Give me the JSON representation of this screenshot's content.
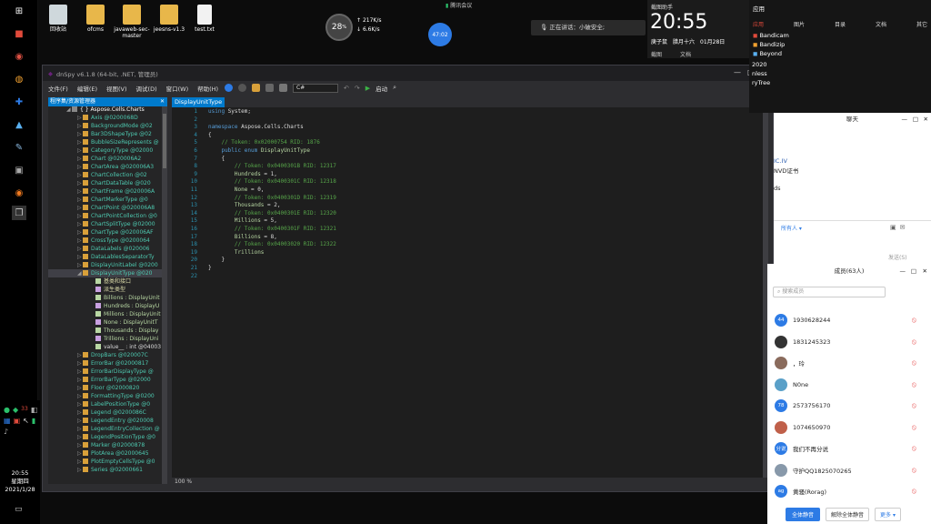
{
  "desktop": {
    "icons": [
      {
        "label": "回收站",
        "color": "#cfd8dc"
      },
      {
        "label": "ofcms",
        "color": "#e8b74a"
      },
      {
        "label": "javaweb-sec-master",
        "color": "#e8b74a"
      },
      {
        "label": "jeesns-v1.3",
        "color": "#e8b74a"
      },
      {
        "label": "test.txt",
        "color": "#f2f2f2"
      }
    ],
    "net_badge": {
      "percent": "28",
      "unit": "%",
      "up": "217",
      "up_unit": "K/s",
      "down": "6.6",
      "down_unit": "K/s"
    },
    "timer": "47:02",
    "meeting_label": "腾讯会议",
    "speaking": "正在讲话：小破安全;"
  },
  "dnspy": {
    "title": "dnSpy v6.1.8 (64-bit, .NET, 管理员)",
    "menu": [
      "文件(F)",
      "编辑(E)",
      "视图(V)",
      "调试(D)",
      "窗口(W)",
      "帮助(H)"
    ],
    "language": "C#",
    "run_label": "启动",
    "tree_header": "程序集/资源管理器",
    "tree": [
      {
        "text": "{ } Aspose.Cells.Charts",
        "indent": 0,
        "color": "#ffffff",
        "expanded": true
      },
      {
        "text": "Axis @0200068D",
        "indent": 1
      },
      {
        "text": "BackgroundMode @02",
        "indent": 1
      },
      {
        "text": "Bar3DShapeType @02",
        "indent": 1
      },
      {
        "text": "BubbleSizeRepresents @",
        "indent": 1
      },
      {
        "text": "CategoryType @02000",
        "indent": 1
      },
      {
        "text": "Chart @020006A2",
        "indent": 1
      },
      {
        "text": "ChartArea @020006A3",
        "indent": 1
      },
      {
        "text": "ChartCollection @02",
        "indent": 1
      },
      {
        "text": "ChartDataTable @020",
        "indent": 1
      },
      {
        "text": "ChartFrame @020006A",
        "indent": 1
      },
      {
        "text": "ChartMarkerType @0",
        "indent": 1
      },
      {
        "text": "ChartPoint @020006A8",
        "indent": 1
      },
      {
        "text": "ChartPointCollection @0",
        "indent": 1
      },
      {
        "text": "ChartSplitType @02000",
        "indent": 1
      },
      {
        "text": "ChartType @020006AF",
        "indent": 1
      },
      {
        "text": "CrossType @0200064",
        "indent": 1
      },
      {
        "text": "DataLabels @020006",
        "indent": 1
      },
      {
        "text": "DataLablesSeparatorTy",
        "indent": 1
      },
      {
        "text": "DisplayUnitLabel @0200",
        "indent": 1
      },
      {
        "text": "DisplayUnitType @020",
        "indent": 1,
        "selected": true,
        "expanded": true
      },
      {
        "text": "基类和接口",
        "indent": 2,
        "color": "#dcdcaa"
      },
      {
        "text": "派生类型",
        "indent": 2,
        "color": "#dcdcaa"
      },
      {
        "text": "Billions : DisplayUnit",
        "indent": 2,
        "color": "#b8d7a3"
      },
      {
        "text": "Hundreds : DisplayU",
        "indent": 2,
        "color": "#b8d7a3"
      },
      {
        "text": "Millions : DisplayUnit",
        "indent": 2,
        "color": "#b8d7a3"
      },
      {
        "text": "None : DisplayUnitT",
        "indent": 2,
        "color": "#b8d7a3"
      },
      {
        "text": "Thousands : Display",
        "indent": 2,
        "color": "#b8d7a3"
      },
      {
        "text": "Trillions : DisplayUni",
        "indent": 2,
        "color": "#b8d7a3"
      },
      {
        "text": "value__ : int @04003",
        "indent": 2,
        "color": "#dcdcdc"
      },
      {
        "text": "DropBars @020007C",
        "indent": 1
      },
      {
        "text": "ErrorBar @02000817",
        "indent": 1
      },
      {
        "text": "ErrorBarDisplayType @",
        "indent": 1
      },
      {
        "text": "ErrorBarType @02000",
        "indent": 1
      },
      {
        "text": "Floor @02000820",
        "indent": 1
      },
      {
        "text": "FormattingType @0200",
        "indent": 1
      },
      {
        "text": "LabelPositionType @0",
        "indent": 1
      },
      {
        "text": "Legend @0200086C",
        "indent": 1
      },
      {
        "text": "LegendEntry @020008",
        "indent": 1
      },
      {
        "text": "LegendEntryCollection @",
        "indent": 1
      },
      {
        "text": "LegendPositionType @0",
        "indent": 1
      },
      {
        "text": "Marker @02000878",
        "indent": 1
      },
      {
        "text": "PlotArea @02000645",
        "indent": 1
      },
      {
        "text": "PlotEmptyCellsType @0",
        "indent": 1
      },
      {
        "text": "Series @02000661",
        "indent": 1
      }
    ],
    "tab_label": "DisplayUnitType",
    "code": [
      {
        "n": "1",
        "parts": [
          [
            "using ",
            "#569cd6"
          ],
          [
            "System",
            "#dcdcdc"
          ],
          [
            ";",
            "#dcdcdc"
          ]
        ]
      },
      {
        "n": "2",
        "parts": []
      },
      {
        "n": "3",
        "parts": [
          [
            "namespace ",
            "#569cd6"
          ],
          [
            "Aspose.Cells.Charts",
            "#dcdcdc"
          ]
        ]
      },
      {
        "n": "4",
        "parts": [
          [
            "{",
            "#dcdcdc"
          ]
        ]
      },
      {
        "n": "5",
        "parts": [
          [
            "\t// Token: 0x02000754 RID: 1876",
            "#57a64a"
          ]
        ]
      },
      {
        "n": "6",
        "parts": [
          [
            "\tpublic enum ",
            "#569cd6"
          ],
          [
            "DisplayUnitType",
            "#b8d7a3"
          ]
        ]
      },
      {
        "n": "7",
        "parts": [
          [
            "\t{",
            "#dcdcdc"
          ]
        ]
      },
      {
        "n": "8",
        "parts": [
          [
            "\t\t// Token: 0x0400301B RID: 12317",
            "#57a64a"
          ]
        ]
      },
      {
        "n": "9",
        "parts": [
          [
            "\t\tHundreds",
            "#b8d7a3"
          ],
          [
            " = 1,",
            "#dcdcdc"
          ]
        ]
      },
      {
        "n": "10",
        "parts": [
          [
            "\t\t// Token: 0x0400301C RID: 12318",
            "#57a64a"
          ]
        ]
      },
      {
        "n": "11",
        "parts": [
          [
            "\t\tNone",
            "#b8d7a3"
          ],
          [
            " = 0,",
            "#dcdcdc"
          ]
        ]
      },
      {
        "n": "12",
        "parts": [
          [
            "\t\t// Token: 0x0400301D RID: 12319",
            "#57a64a"
          ]
        ]
      },
      {
        "n": "13",
        "parts": [
          [
            "\t\tThousands",
            "#b8d7a3"
          ],
          [
            " = 2,",
            "#dcdcdc"
          ]
        ]
      },
      {
        "n": "14",
        "parts": [
          [
            "\t\t// Token: 0x0400301E RID: 12320",
            "#57a64a"
          ]
        ]
      },
      {
        "n": "15",
        "parts": [
          [
            "\t\tMillions",
            "#b8d7a3"
          ],
          [
            " = 5,",
            "#dcdcdc"
          ]
        ]
      },
      {
        "n": "16",
        "parts": [
          [
            "\t\t// Token: 0x0400301F RID: 12321",
            "#57a64a"
          ]
        ]
      },
      {
        "n": "17",
        "parts": [
          [
            "\t\tBillions",
            "#b8d7a3"
          ],
          [
            " = 8,",
            "#dcdcdc"
          ]
        ]
      },
      {
        "n": "18",
        "parts": [
          [
            "\t\t// Token: 0x04003020 RID: 12322",
            "#57a64a"
          ]
        ]
      },
      {
        "n": "19",
        "parts": [
          [
            "\t\tTrillions",
            "#b8d7a3"
          ]
        ]
      },
      {
        "n": "20",
        "parts": [
          [
            "\t}",
            "#dcdcdc"
          ]
        ]
      },
      {
        "n": "21",
        "parts": [
          [
            "}",
            "#dcdcdc"
          ]
        ]
      },
      {
        "n": "22",
        "parts": []
      }
    ],
    "zoom": "100 %"
  },
  "clock": {
    "label": "截图助手",
    "time": "20:55",
    "weekday": "庚子鼠",
    "lunar": "腊月十六",
    "date": "01月28日",
    "links": [
      "截图",
      "文档"
    ]
  },
  "search_panel": {
    "title": "应用",
    "tabs": [
      "应用",
      "图片",
      "目录",
      "文档",
      "其它"
    ],
    "apps": [
      "Bandicam",
      "Bandizip",
      "Beyond"
    ],
    "extra": [
      "2020",
      "nless",
      "ryTree"
    ]
  },
  "chat": {
    "title": "聊天",
    "lines": [
      "IC.IV",
      "NVD证书",
      "ds"
    ],
    "recipient": "所有人",
    "send": "发送(S)"
  },
  "members": {
    "title": "成员(63人)",
    "search_placeholder": "搜索成员",
    "list": [
      {
        "name": "1930628244",
        "avatar": "44",
        "color": "#2d7be5"
      },
      {
        "name": "1831245323",
        "avatar": "",
        "color": "#333333"
      },
      {
        "name": "，玲",
        "avatar": "",
        "color": "#8a6b5c"
      },
      {
        "name": "N0ne",
        "avatar": "",
        "color": "#5aa0c8"
      },
      {
        "name": "2573756170",
        "avatar": "78",
        "color": "#2d7be5"
      },
      {
        "name": "1074650970",
        "avatar": "",
        "color": "#c0604a"
      },
      {
        "name": "我们不再分说",
        "avatar": "分说",
        "color": "#2d7be5"
      },
      {
        "name": "守护QQ1825070265",
        "avatar": "",
        "color": "#8899aa"
      },
      {
        "name": "黄骚(Rorag)",
        "avatar": "ag",
        "color": "#2d7be5"
      }
    ],
    "mute_all": "全体静音",
    "unmute_all": "解除全体静音",
    "more": "更多"
  },
  "tray": {
    "time": "20:55",
    "day": "星期四",
    "date": "2021/1/28",
    "badge": "33"
  }
}
